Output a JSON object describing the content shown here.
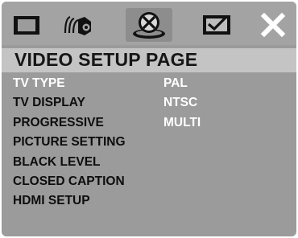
{
  "toolbar": {
    "icons": [
      {
        "name": "general-setup-icon"
      },
      {
        "name": "audio-setup-icon"
      },
      {
        "name": "video-setup-icon",
        "active": true
      },
      {
        "name": "preference-setup-icon"
      },
      {
        "name": "exit-icon"
      }
    ]
  },
  "page": {
    "title": "VIDEO SETUP PAGE"
  },
  "menu": {
    "selected_index": 0,
    "items": [
      {
        "label": "TV TYPE"
      },
      {
        "label": "TV DISPLAY"
      },
      {
        "label": "PROGRESSIVE"
      },
      {
        "label": "PICTURE SETTING"
      },
      {
        "label": "BLACK LEVEL"
      },
      {
        "label": "CLOSED CAPTION"
      },
      {
        "label": "HDMI SETUP"
      }
    ]
  },
  "options": {
    "items": [
      {
        "label": "PAL"
      },
      {
        "label": "NTSC"
      },
      {
        "label": "MULTI"
      }
    ]
  },
  "colors": {
    "background": "#9b9b9b",
    "title_band": "#c4c4c4",
    "highlight_text": "#ffffff",
    "normal_text": "#0d0d0d"
  }
}
